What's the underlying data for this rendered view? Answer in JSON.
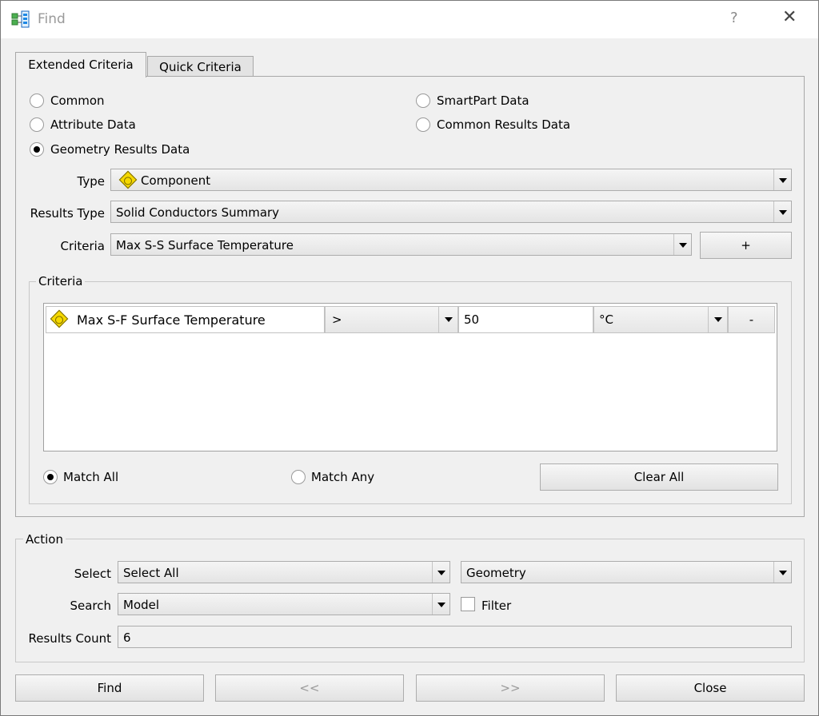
{
  "window": {
    "title": "Find",
    "help_label": "?",
    "close_label": "✕"
  },
  "tabs": [
    {
      "label": "Extended Criteria",
      "active": true
    },
    {
      "label": "Quick Criteria",
      "active": false
    }
  ],
  "data_source": {
    "options": [
      "Common",
      "Attribute Data",
      "Geometry Results Data",
      "SmartPart Data",
      "Common Results Data"
    ],
    "selected": "Geometry Results Data"
  },
  "type_field": {
    "label": "Type",
    "value": "Component",
    "icon": "component-icon"
  },
  "results_type_field": {
    "label": "Results Type",
    "value": "Solid Conductors Summary"
  },
  "criteria_field": {
    "label": "Criteria",
    "value": "Max S-S Surface Temperature",
    "add_label": "+"
  },
  "criteria_group": {
    "title": "Criteria",
    "rows": [
      {
        "name": "Max S-F Surface Temperature",
        "icon": "component-icon",
        "operator": ">",
        "value": "50",
        "unit": "°C",
        "remove_label": "-"
      }
    ],
    "match_all_label": "Match All",
    "match_any_label": "Match Any",
    "match_selected": "Match All",
    "clear_all_label": "Clear All"
  },
  "action_group": {
    "title": "Action",
    "select_label": "Select",
    "select_value": "Select All",
    "target_value": "Geometry",
    "search_label": "Search",
    "search_value": "Model",
    "filter_label": "Filter",
    "filter_checked": false,
    "results_count_label": "Results Count",
    "results_count_value": "6"
  },
  "footer": {
    "find_label": "Find",
    "prev_label": "<<",
    "next_label": ">>",
    "close_label": "Close"
  }
}
